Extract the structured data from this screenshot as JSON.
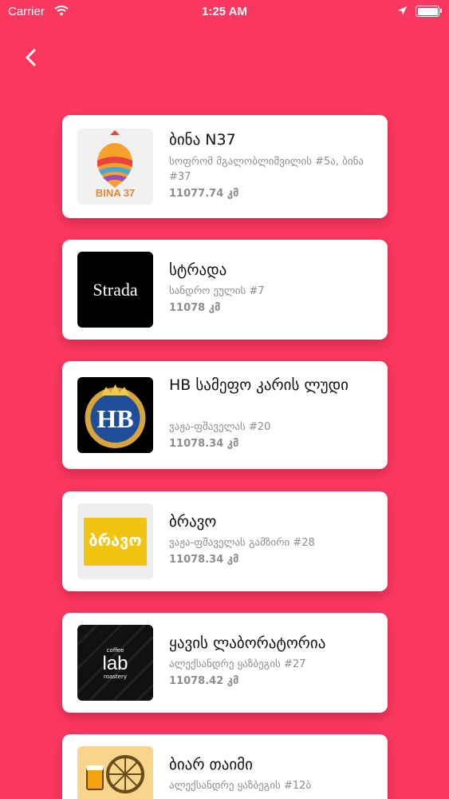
{
  "status_bar": {
    "carrier": "Carrier",
    "time": "1:25 AM"
  },
  "nav": {
    "back_icon": "chevron-left-icon"
  },
  "places": [
    {
      "name": "ბინა N37",
      "address": "სოფრომ მგალობლიშვილის #5ა, ბინა #37",
      "distance": "11077.74 კმ",
      "logo_text": "BINA 37"
    },
    {
      "name": "სტრადა",
      "address": "სანდრო ეულის #7",
      "distance": "11078 კმ",
      "logo_text": "Strada"
    },
    {
      "name": "HB სამეფო კარის ლუდი",
      "address": "ვაჟა-ფშაველას #20",
      "distance": "11078.34 კმ",
      "logo_text": "HB"
    },
    {
      "name": "ბრავო",
      "address": "ვაჟა-ფშაველას გამზირი #28",
      "distance": "11078.34 კმ",
      "logo_text": "ბრავო"
    },
    {
      "name": "ყავის ლაბორატორია",
      "address": "ალექსანდრე ყაზბეგის #27",
      "distance": "11078.42 კმ",
      "logo_text": "lab",
      "logo_small_top": "coffee",
      "logo_small_bottom": "roastery"
    },
    {
      "name": "ბიარ თაიმი",
      "address": "ალექსანდრე ყაზბეგის #12ბ",
      "distance": "",
      "logo_text": ""
    }
  ],
  "colors": {
    "background": "#fb3860",
    "card": "#ffffff",
    "title": "#111111",
    "secondary_text": "#8d8d8d"
  }
}
